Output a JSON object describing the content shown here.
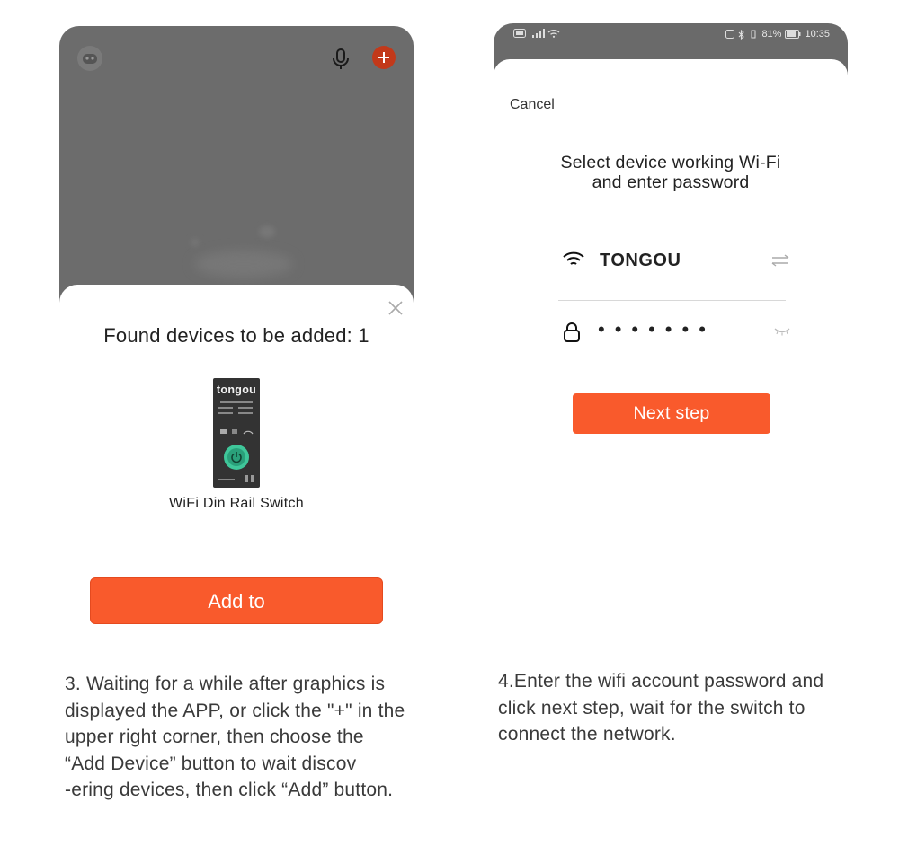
{
  "left_screen": {
    "sheet_title": "Found devices to be added: 1",
    "device": {
      "brand": "tongou",
      "name": "WiFi Din Rail Switch"
    },
    "add_button_label": "Add to",
    "icons": [
      "user-avatar-icon",
      "microphone-icon",
      "plus-icon",
      "close-icon",
      "power-icon"
    ]
  },
  "right_screen": {
    "status_bar": {
      "battery": "81%",
      "time": "10:35"
    },
    "cancel_label": "Cancel",
    "heading_line1": "Select device working Wi-Fi",
    "heading_line2": "and enter password",
    "wifi_name": "TONGOU",
    "password_masked": "•••••••",
    "next_button_label": "Next step",
    "icons": [
      "wifi-icon",
      "switch-network-icon",
      "lock-icon",
      "eye-closed-icon"
    ]
  },
  "captions": {
    "left_lines": [
      "3. Waiting for a while after graphics is",
      "displayed the APP, or click the \"+\" in the",
      "upper right corner, then choose the",
      "“Add Device”  button to wait discov",
      "-ering devices, then click “Add” button."
    ],
    "right_lines": [
      "4.Enter the wifi account password and",
      "click next step, wait for the switch to",
      "connect the network."
    ]
  },
  "colors": {
    "accent": "#f95a2c",
    "overlay": "#6c6c6c",
    "device_green": "#3fc79a"
  }
}
